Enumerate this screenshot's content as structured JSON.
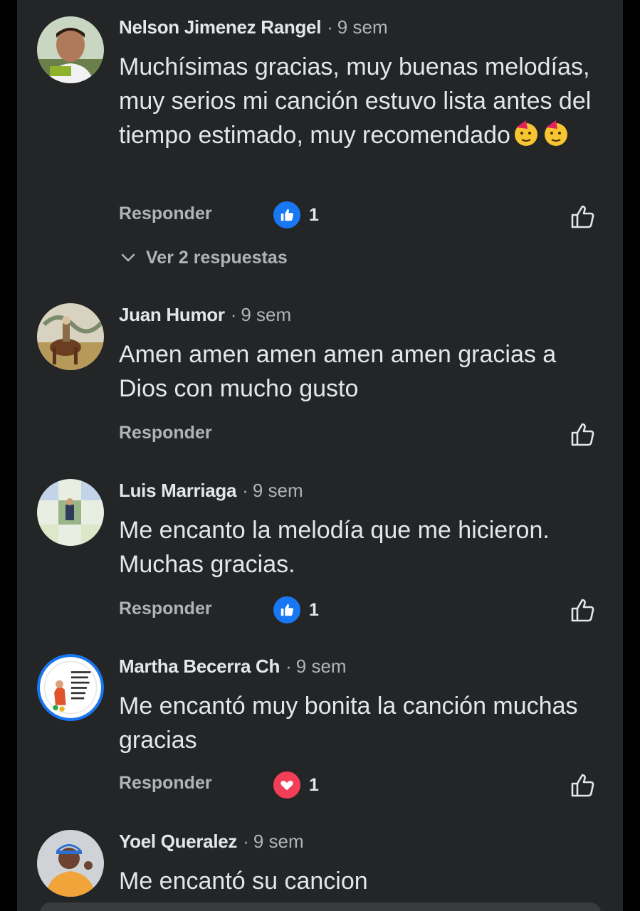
{
  "comments": [
    {
      "name": "Nelson Jimenez Rangel",
      "time": "9 sem",
      "text": "Muchísimas gracias, muy buenas melodías, muy serios mi canción estuvo lista antes del tiempo estimado, muy recomendado",
      "emojis": [
        "partying-face-emoji",
        "partying-face-emoji"
      ],
      "reply_label": "Responder",
      "reaction": {
        "type": "like",
        "count": "1",
        "color": "#1877f2"
      },
      "more_replies": "Ver 2 respuestas"
    },
    {
      "name": "Juan Humor",
      "time": "9 sem",
      "text": "Amen amen amen amen amen gracias a Dios con mucho gusto",
      "reply_label": "Responder"
    },
    {
      "name": "Luis Marriaga",
      "time": "9 sem",
      "text": "Me encanto la melodía que me hicieron. Muchas gracias.",
      "reply_label": "Responder",
      "reaction": {
        "type": "like",
        "count": "1",
        "color": "#1877f2"
      }
    },
    {
      "name": "Martha Becerra Ch",
      "time": "9 sem",
      "text": "Me encantó muy bonita la canción muchas gracias",
      "reply_label": "Responder",
      "reaction": {
        "type": "love",
        "count": "1",
        "color": "#f33e58"
      }
    },
    {
      "name": "Yoel Queralez",
      "time": "9 sem",
      "text": "Me encantó su cancion"
    }
  ],
  "colors": {
    "background": "#242526",
    "text_primary": "#e4e6eb",
    "text_secondary": "#b0b3b8",
    "like_blue": "#1877f2",
    "love_red": "#f33e58"
  }
}
